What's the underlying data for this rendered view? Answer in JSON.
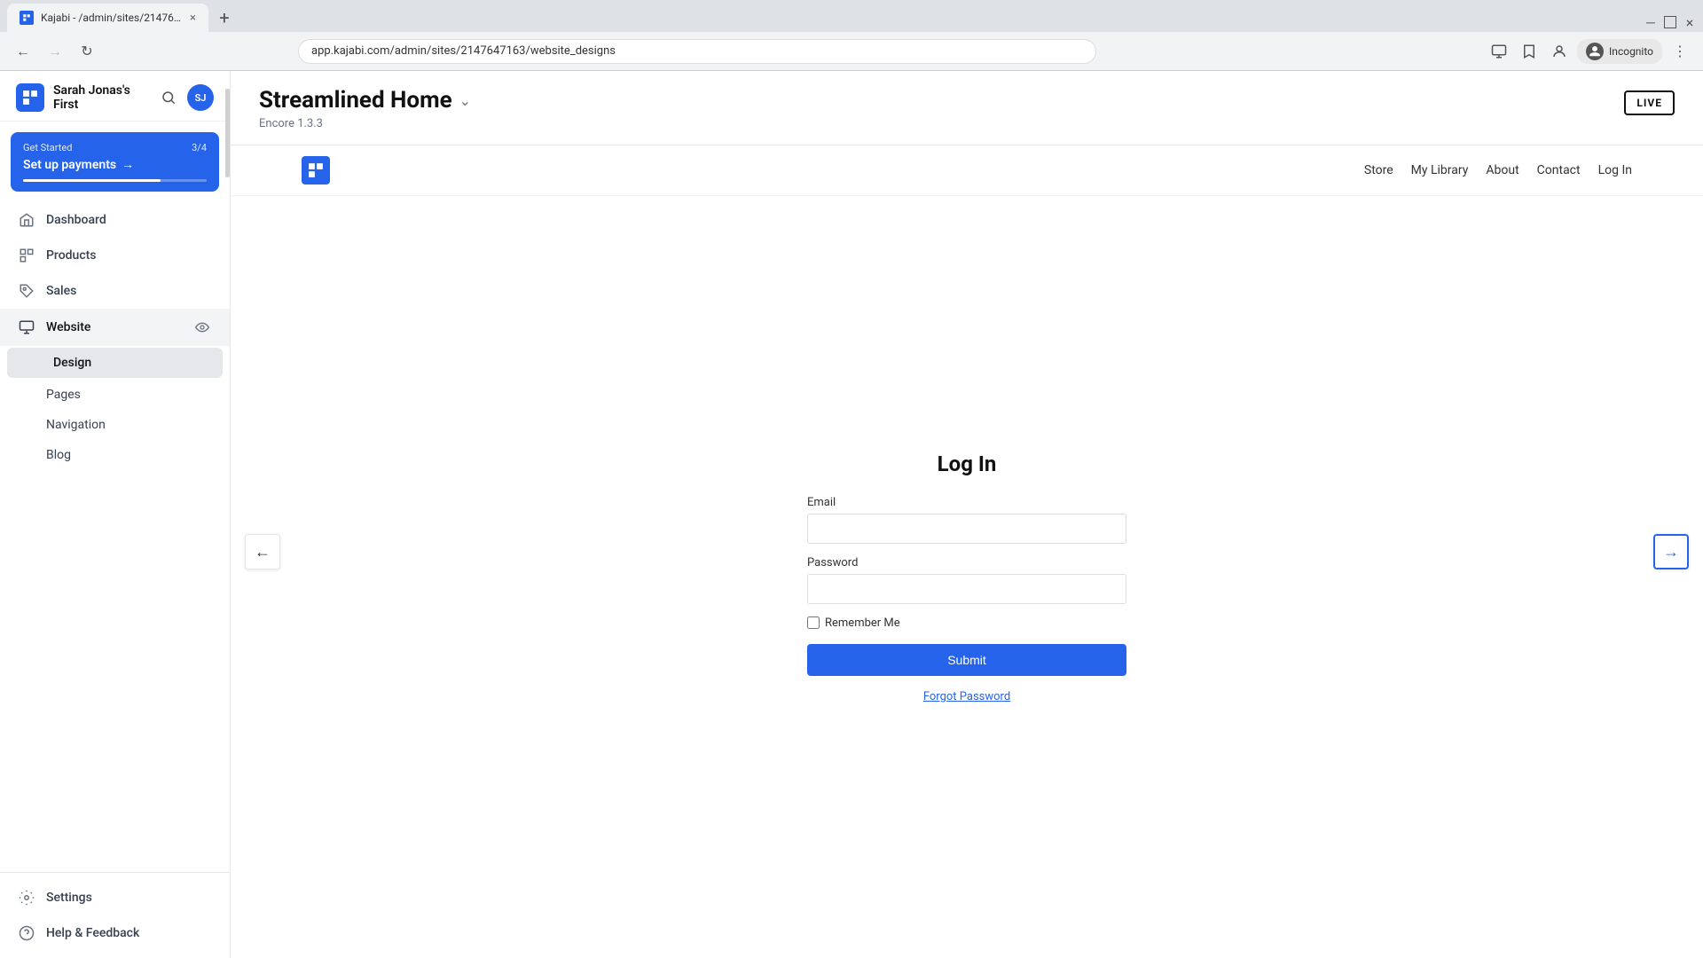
{
  "browser": {
    "tab_title": "Kajabi - /admin/sites/214764716...",
    "url": "app.kajabi.com/admin/sites/2147647163/website_designs",
    "new_tab_label": "+",
    "incognito_label": "Incognito",
    "incognito_initials": "SJ"
  },
  "app": {
    "site_name": "Sarah Jonas's First",
    "logo_icon": "kajabi-logo"
  },
  "sidebar": {
    "get_started": {
      "label": "Get Started",
      "progress": "3/4",
      "cta": "Set up payments",
      "arrow": "→"
    },
    "nav_items": [
      {
        "id": "dashboard",
        "label": "Dashboard",
        "icon": "home-icon"
      },
      {
        "id": "products",
        "label": "Products",
        "icon": "grid-icon"
      },
      {
        "id": "sales",
        "label": "Sales",
        "icon": "tag-icon"
      },
      {
        "id": "website",
        "label": "Website",
        "icon": "monitor-icon",
        "active": true,
        "has_eye": true
      }
    ],
    "sub_nav": [
      {
        "id": "design",
        "label": "Design",
        "active": true
      },
      {
        "id": "pages",
        "label": "Pages"
      },
      {
        "id": "navigation",
        "label": "Navigation"
      },
      {
        "id": "blog",
        "label": "Blog"
      }
    ],
    "bottom_nav": [
      {
        "id": "settings",
        "label": "Settings",
        "icon": "gear-icon"
      },
      {
        "id": "help",
        "label": "Help & Feedback",
        "icon": "question-icon"
      }
    ]
  },
  "main": {
    "title": "Streamlined Home",
    "subtitle": "Encore 1.3.3",
    "live_badge": "LIVE",
    "preview": {
      "nav_links": [
        {
          "label": "Store"
        },
        {
          "label": "My Library"
        },
        {
          "label": "About"
        },
        {
          "label": "Contact"
        },
        {
          "label": "Log In"
        }
      ],
      "login": {
        "title": "Log In",
        "email_label": "Email",
        "password_label": "Password",
        "remember_label": "Remember Me",
        "submit_label": "Submit",
        "forgot_label": "Forgot Password"
      }
    },
    "nav_prev": "←",
    "nav_next": "→"
  }
}
